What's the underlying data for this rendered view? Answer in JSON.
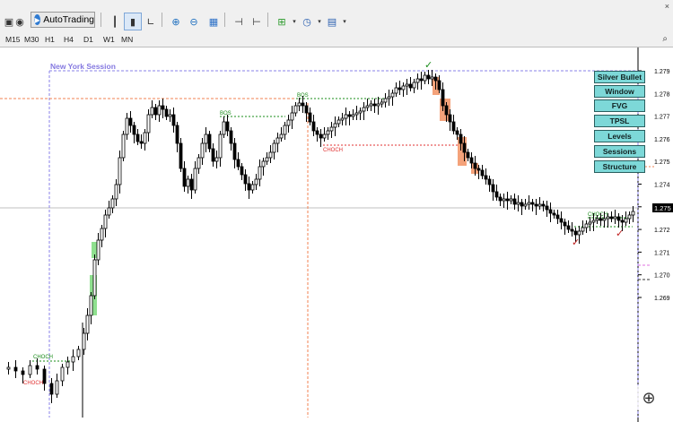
{
  "toolbar": {
    "autotrading_label": "AutoTrading",
    "window_close": "×"
  },
  "timeframes": [
    "M15",
    "M30",
    "H1",
    "H4",
    "D1",
    "W1",
    "MN"
  ],
  "chart": {
    "session_label": "New York Session",
    "bos_label": "BOS",
    "choch_label": "CHOCH",
    "current_price": "1.275",
    "price_axis": [
      "1.279",
      "1.278",
      "1.277",
      "1.276",
      "1.275",
      "1.274",
      "1.273",
      "1.272",
      "1.271",
      "1.270",
      "1.269"
    ],
    "colors": {
      "bull": "#ffffff",
      "bear": "#000000",
      "bos": "#1a8c1a",
      "choch": "#e03030",
      "session": "#7d75e0",
      "ob_bear": "#f4a27a",
      "ob_bull": "#8fe08f",
      "panel_button": "#7dd8d8"
    }
  },
  "panel": {
    "buttons": [
      "Silver Bullet",
      "Window",
      "FVG",
      "TPSL",
      "Levels",
      "Sessions",
      "Structure"
    ]
  }
}
